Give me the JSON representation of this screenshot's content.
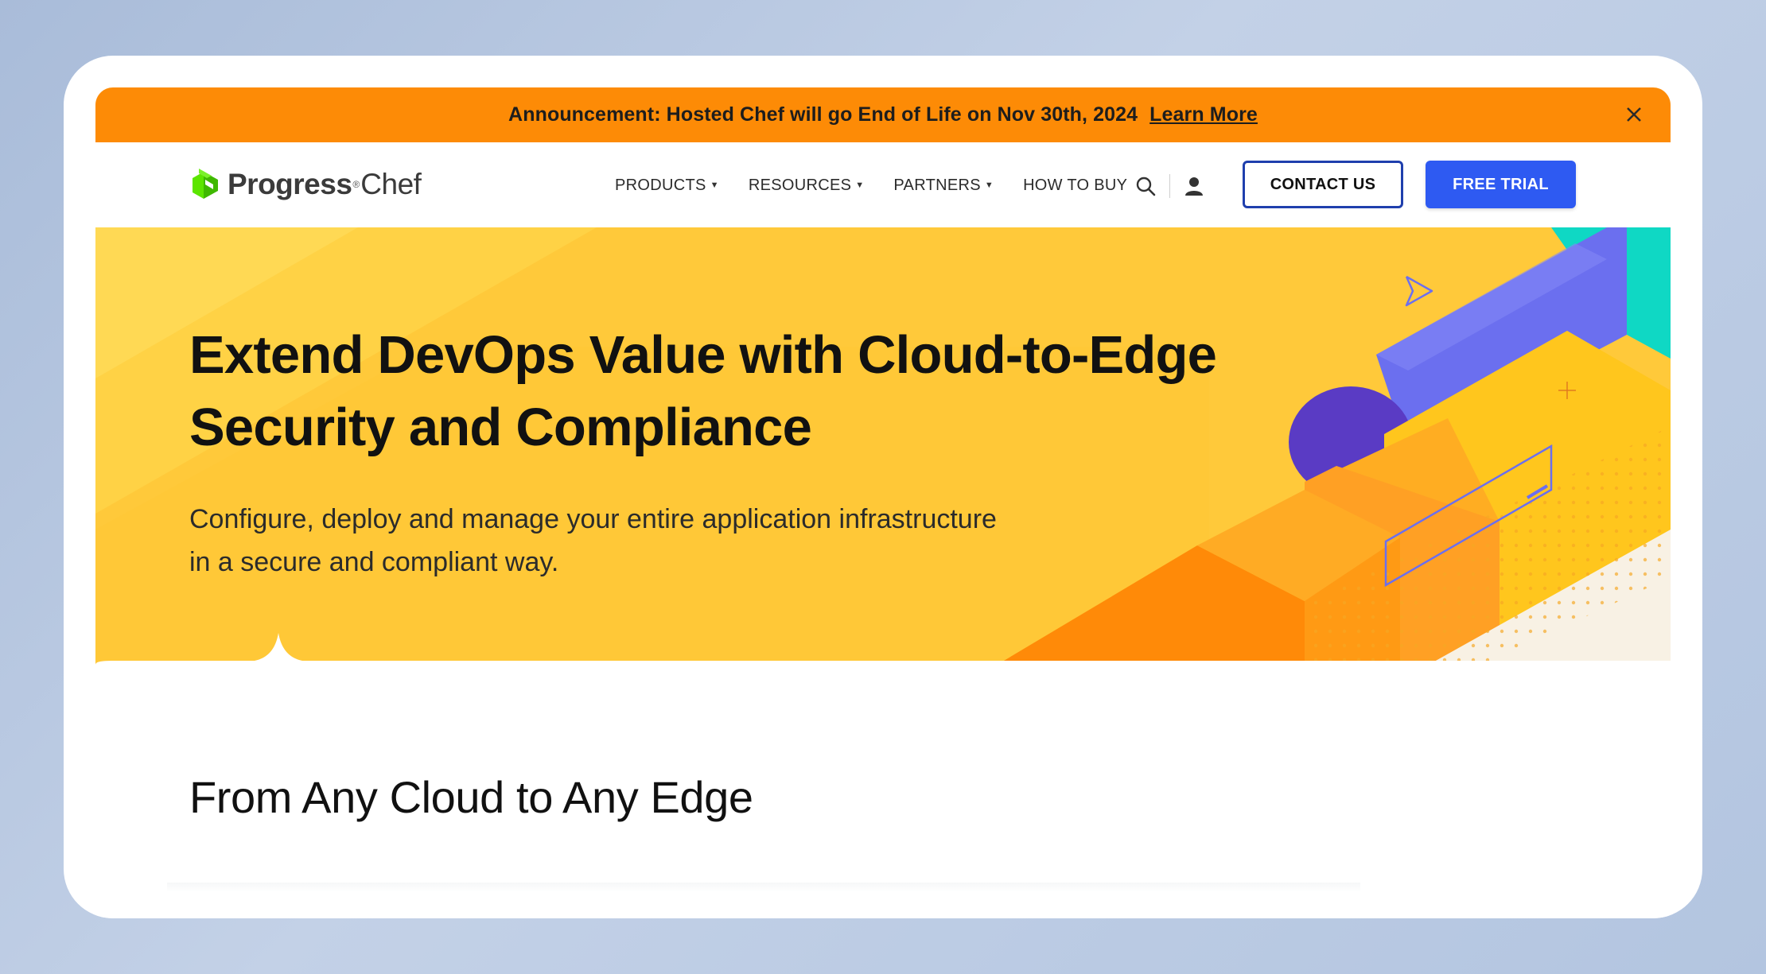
{
  "announcement": {
    "text": "Announcement: Hosted Chef will go End of Life on Nov 30th, 2024",
    "link_label": "Learn More",
    "close_icon": "close-icon",
    "background": "#fd8b06"
  },
  "logo": {
    "brand": "Progress",
    "registered": "®",
    "product": "Chef",
    "icon": "progress-logo-icon",
    "accent": "#5ce500"
  },
  "nav": {
    "items": [
      {
        "label": "PRODUCTS",
        "has_dropdown": true
      },
      {
        "label": "RESOURCES",
        "has_dropdown": true
      },
      {
        "label": "PARTNERS",
        "has_dropdown": true
      },
      {
        "label": "HOW TO BUY",
        "has_dropdown": false
      }
    ],
    "search_icon": "search-icon",
    "user_icon": "user-icon",
    "contact_label": "CONTACT US",
    "trial_label": "FREE TRIAL",
    "trial_color": "#2e5af2",
    "contact_border": "#1f3fad"
  },
  "hero": {
    "title_line1": "Extend DevOps Value with Cloud-to-Edge",
    "title_line2": "Security and Compliance",
    "subtitle_line1": "Configure, deploy and manage your entire application infrastructure",
    "subtitle_line2": "in a secure and compliant way.",
    "background": "#ffc93a"
  },
  "section": {
    "title": "From Any Cloud to Any Edge"
  }
}
